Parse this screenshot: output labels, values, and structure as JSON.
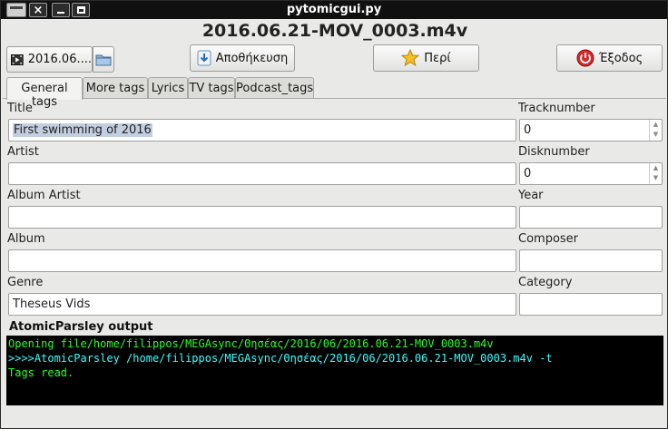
{
  "window": {
    "title": "pytomicgui.py",
    "close_glyph": "×"
  },
  "file_heading": "2016.06.21-MOV_0003.m4v",
  "toolbar": {
    "file_combo_value": "2016.06....",
    "file_combo_icon": "video-file-icon",
    "folder_icon": "folder-icon",
    "save_label": "Αποθήκευση",
    "save_icon": "download-arrow-icon",
    "about_label": "Περί",
    "about_icon": "star-icon",
    "exit_label": "Έξοδος",
    "exit_icon": "power-icon"
  },
  "tabs": [
    {
      "label": "General tags",
      "active": true
    },
    {
      "label": "More tags",
      "active": false
    },
    {
      "label": "Lyrics",
      "active": false
    },
    {
      "label": "TV tags",
      "active": false
    },
    {
      "label": "Podcast_tags",
      "active": false
    }
  ],
  "fields": {
    "title": {
      "label": "Title",
      "value": "First swimming of 2016"
    },
    "artist": {
      "label": "Artist",
      "value": ""
    },
    "album_artist": {
      "label": "Album Artist",
      "value": ""
    },
    "album": {
      "label": "Album",
      "value": ""
    },
    "genre": {
      "label": "Genre",
      "value": "Theseus Vids"
    },
    "tracknumber": {
      "label": "Tracknumber",
      "value": "0"
    },
    "disknumber": {
      "label": "Disknumber",
      "value": "0"
    },
    "year": {
      "label": "Year",
      "value": ""
    },
    "composer": {
      "label": "Composer",
      "value": ""
    },
    "category": {
      "label": "Category",
      "value": ""
    }
  },
  "output": {
    "label": "AtomicParsley output",
    "lines": [
      {
        "text": "Opening file/home/filippos/MEGAsync/Θησέας/2016/06/2016.06.21-MOV_0003.m4v",
        "color": "#25ff25"
      },
      {
        "text": ">>>>AtomicParsley /home/filippos/MEGAsync/Θησέας/2016/06/2016.06.21-MOV_0003.m4v -t",
        "color": "#33ffff"
      },
      {
        "text": "Tags read.",
        "color": "#25ff25"
      }
    ]
  },
  "colors": {
    "titlebar_bg": "#101010",
    "window_bg": "#e9e9e7",
    "console_bg": "#000000",
    "selection": "#c3cfe0"
  }
}
